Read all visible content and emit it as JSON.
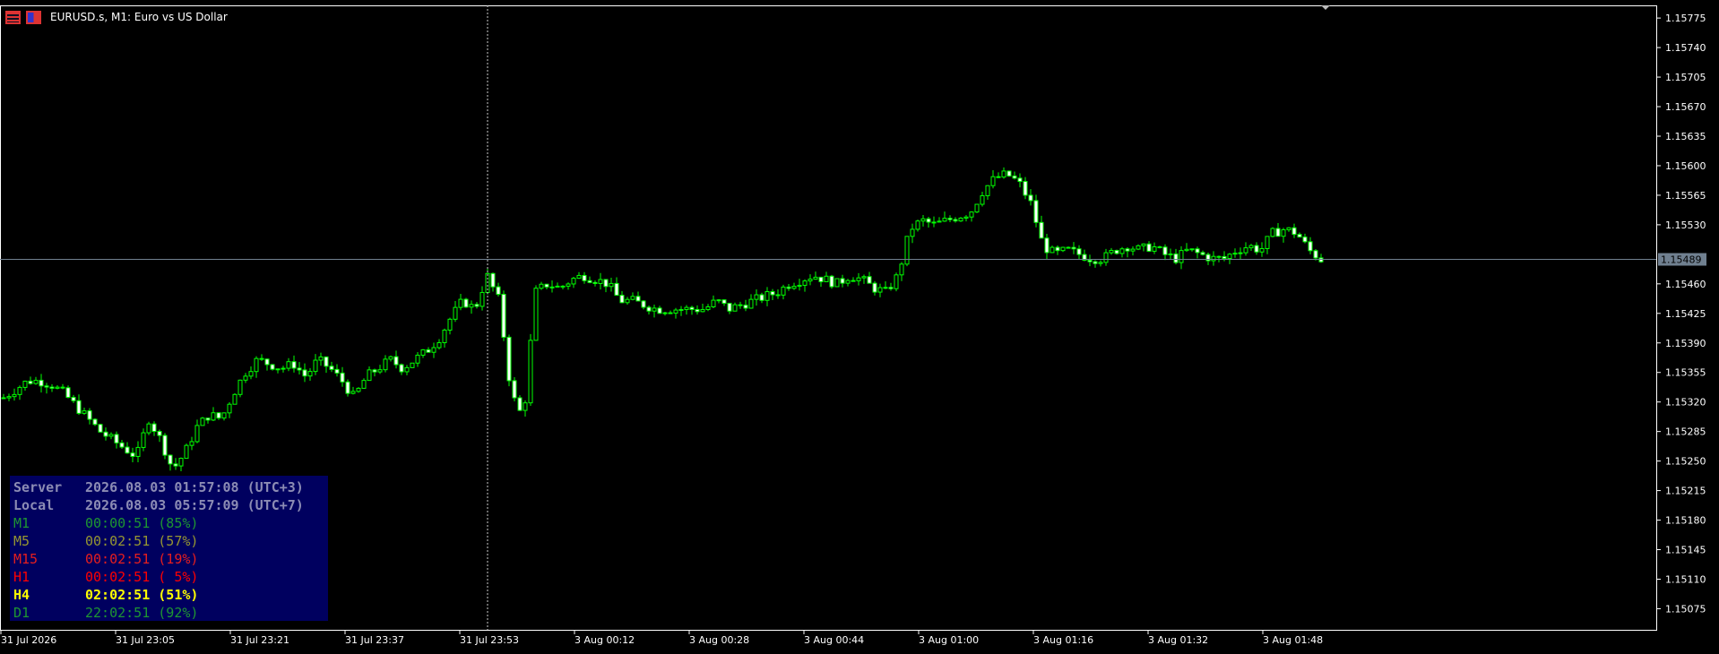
{
  "header": {
    "title": "EURUSD.s, M1:  Euro vs US Dollar"
  },
  "colors": {
    "background": "#000000",
    "bull": "#00ff00",
    "bear": "#ffffff",
    "axis": "#ffffff",
    "price_line": "#708090",
    "price_label_bg": "#708090",
    "panel_bg": "#00005f"
  },
  "chart_data": {
    "type": "candlestick",
    "symbol": "EURUSD.s",
    "timeframe": "M1",
    "ylim": [
      1.1505,
      1.1579
    ],
    "y_ticks": [
      "1.15775",
      "1.15740",
      "1.15705",
      "1.15670",
      "1.15635",
      "1.15600",
      "1.15565",
      "1.15530",
      "1.15460",
      "1.15425",
      "1.15390",
      "1.15355",
      "1.15320",
      "1.15285",
      "1.15250",
      "1.15215",
      "1.15180",
      "1.15145",
      "1.15110",
      "1.15075"
    ],
    "x_ticks": [
      "31 Jul 2026",
      "31 Jul 23:05",
      "31 Jul 23:21",
      "31 Jul 23:37",
      "31 Jul 23:53",
      "3 Aug 00:12",
      "3 Aug 00:28",
      "3 Aug 00:44",
      "3 Aug 01:00",
      "3 Aug 01:16",
      "3 Aug 01:32",
      "3 Aug 01:48"
    ],
    "current_price": 1.15489,
    "current_price_label": "1.15489",
    "close_path": [
      1.15325,
      1.15335,
      1.15345,
      1.15345,
      1.1534,
      1.1533,
      1.15315,
      1.153,
      1.15285,
      1.15275,
      1.15265,
      1.15255,
      1.153,
      1.15275,
      1.1524,
      1.1526,
      1.1529,
      1.15305,
      1.153,
      1.1533,
      1.15355,
      1.1537,
      1.15365,
      1.1536,
      1.15365,
      1.1535,
      1.1537,
      1.1536,
      1.15345,
      1.15325,
      1.1535,
      1.1536,
      1.1537,
      1.1536,
      1.1537,
      1.1538,
      1.15395,
      1.1542,
      1.1544,
      1.1543,
      1.1547,
      1.1544,
      1.1533,
      1.153,
      1.1545,
      1.1546,
      1.15455,
      1.15465,
      1.1547,
      1.15465,
      1.1546,
      1.1544,
      1.1544,
      1.15435,
      1.1543,
      1.1543,
      1.1543,
      1.1543,
      1.1543,
      1.1544,
      1.1543,
      1.15435,
      1.1544,
      1.15445,
      1.1545,
      1.1546,
      1.15465,
      1.1547,
      1.15465,
      1.1546,
      1.1547,
      1.15465,
      1.15455,
      1.1545,
      1.1547,
      1.15525,
      1.15535,
      1.1553,
      1.15535,
      1.1554,
      1.15545,
      1.1557,
      1.15585,
      1.1559,
      1.1558,
      1.15555,
      1.15505,
      1.15495,
      1.155,
      1.15495,
      1.1549,
      1.1549,
      1.155,
      1.15505,
      1.155,
      1.15505,
      1.15495,
      1.1549,
      1.155,
      1.15495,
      1.1549,
      1.1549,
      1.155,
      1.15505,
      1.155,
      1.1552,
      1.15525,
      1.1552,
      1.155,
      1.15489
    ]
  },
  "panel": {
    "rows": [
      {
        "label": "Server",
        "value": "2026.08.03 01:57:08 (UTC+3)",
        "color": "#8c8cb4",
        "bold": true
      },
      {
        "label": "Local",
        "value": "2026.08.03 05:57:09 (UTC+7)",
        "color": "#8c8cb4",
        "bold": true
      },
      {
        "label": "M1",
        "value": "00:00:51 (85%)",
        "color": "#1e9632",
        "bold": false
      },
      {
        "label": "M5",
        "value": "00:02:51 (57%)",
        "color": "#969632",
        "bold": false
      },
      {
        "label": "M15",
        "value": "00:02:51 (19%)",
        "color": "#e61e1e",
        "bold": false
      },
      {
        "label": "H1",
        "value": "00:02:51 ( 5%)",
        "color": "#ff0000",
        "bold": false
      },
      {
        "label": "H4",
        "value": "02:02:51 (51%)",
        "color": "#ffff00",
        "bold": true
      },
      {
        "label": "D1",
        "value": "22:02:51 (92%)",
        "color": "#1e9632",
        "bold": false
      }
    ]
  }
}
